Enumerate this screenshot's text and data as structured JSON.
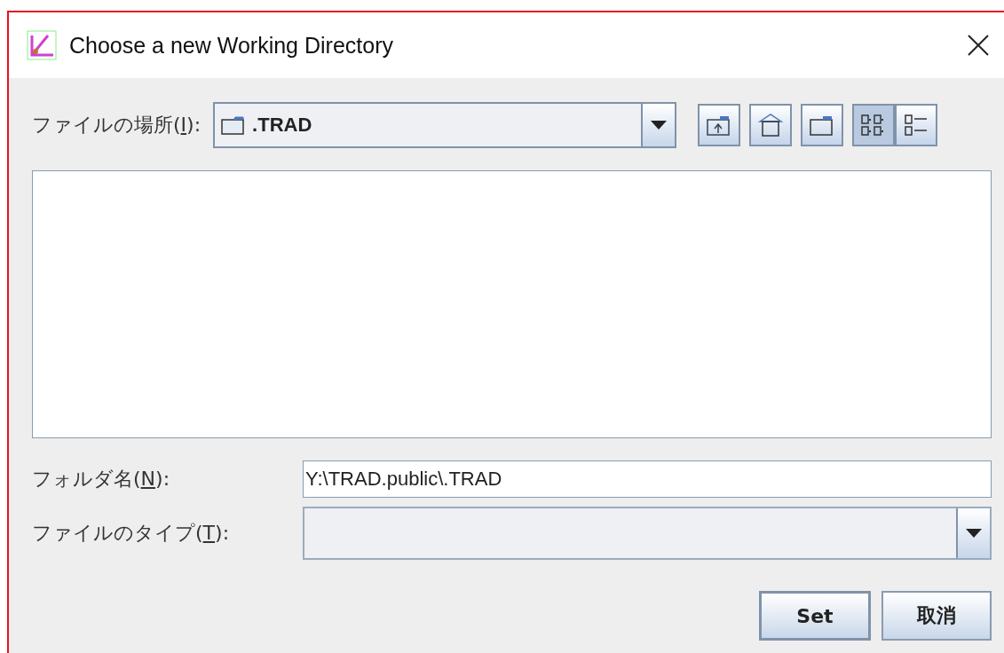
{
  "window": {
    "title": "Choose a new Working Directory"
  },
  "look_in": {
    "label_parts": [
      "ファイルの場所(",
      "I",
      "):"
    ],
    "value": ".TRAD"
  },
  "toolbar": [
    {
      "kind": "up"
    },
    {
      "kind": "home"
    },
    {
      "kind": "new-folder"
    }
  ],
  "view_toggles": [
    {
      "kind": "list",
      "selected": true
    },
    {
      "kind": "details",
      "selected": false
    }
  ],
  "folder_name": {
    "label_parts": [
      "フォルダ名(",
      "N",
      "):"
    ],
    "value": "Y:\\TRAD.public\\.TRAD"
  },
  "file_type": {
    "label_parts": [
      "ファイルのタイプ(",
      "T",
      "):"
    ]
  },
  "buttons": [
    {
      "label": "Set",
      "default": true
    },
    {
      "label": "取消",
      "default": false
    }
  ]
}
